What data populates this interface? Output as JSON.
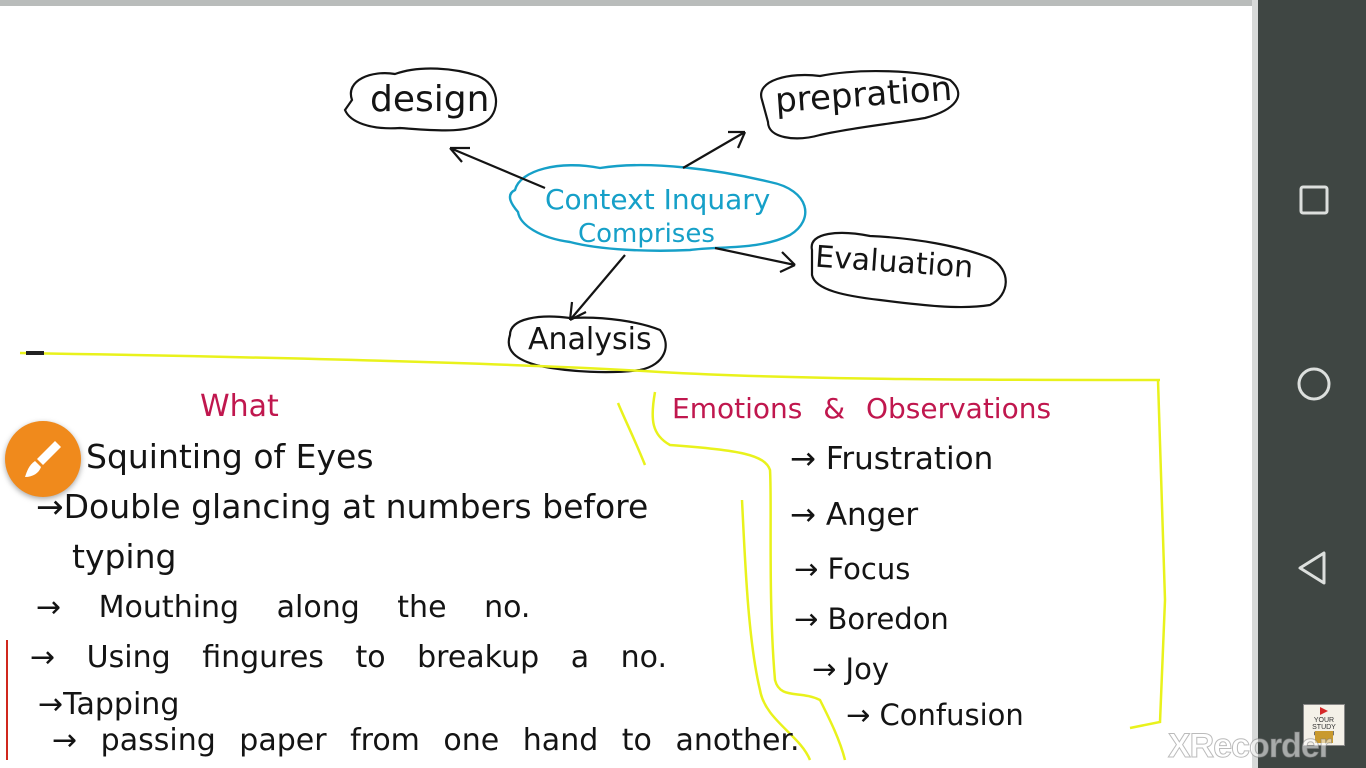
{
  "mindmap": {
    "center": "Context Inquary Comprises",
    "center_line1": "Context Inquary",
    "center_line2": "Comprises",
    "nodes": {
      "design": "design",
      "prepration": "prepration",
      "evaluation": "Evaluation",
      "analysis": "Analysis"
    }
  },
  "what": {
    "heading": "What",
    "items": [
      "Squinting of Eyes",
      "→Double glancing at numbers before",
      "typing",
      "→ Mouthing along the no.",
      "→ Using fingures to breakup a no.",
      "→Tapping",
      "→ passing paper from one hand to another."
    ]
  },
  "emotions": {
    "heading": "Emotions & Observations",
    "items": [
      "→ Frustration",
      "→ Anger",
      "→ Focus",
      "→ Boredon",
      "→ Joy",
      "→ Confusion"
    ]
  },
  "nav": {
    "recents": "square-recents-icon",
    "home": "circle-home-icon",
    "back": "triangle-back-icon"
  },
  "fab_icon": "paintbrush-icon",
  "watermark": "XRecorder",
  "logo": {
    "line1": "YOUR",
    "line2": "STUDY GURU"
  },
  "colors": {
    "ink": "#141414",
    "center_blue": "#16a0c8",
    "heading_pink": "#c0174e",
    "highlight_yellow": "#e9f21c",
    "fab_orange": "#f08a1c",
    "navbar": "#3f4643"
  }
}
